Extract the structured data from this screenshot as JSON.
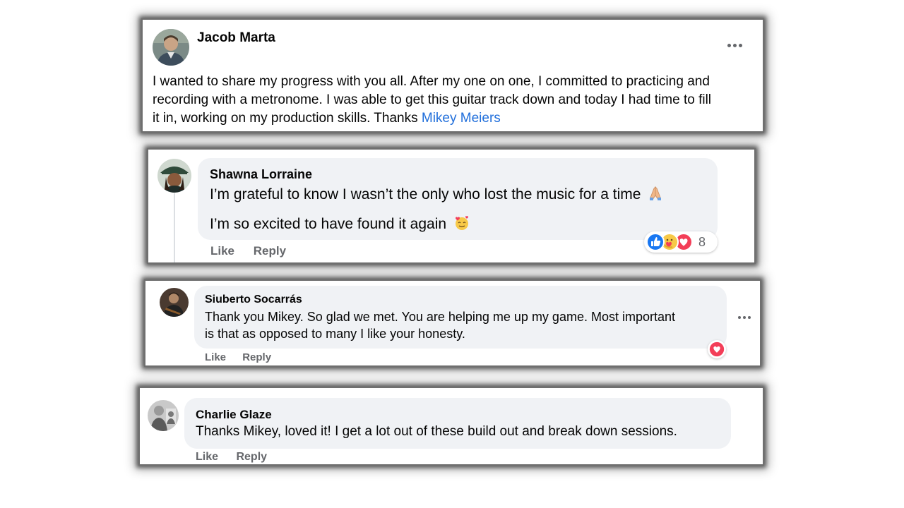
{
  "post": {
    "author": "Jacob Marta",
    "text_line1": "I wanted to share my progress with you all. After my one on one, I committed to practicing and",
    "text_line2": "recording with a metronome. I was able to get this guitar track down and today I had time to fill",
    "text_line3": "it in, working on my production skills. Thanks ",
    "mention": "Mikey Meiers"
  },
  "comments": [
    {
      "author": "Shawna Lorraine",
      "line1": "I’m grateful to know I wasn’t the only who lost the music for a time",
      "line2": "I’m so excited to have found it again",
      "like_label": "Like",
      "reply_label": "Reply",
      "reaction_count": "8",
      "reactions": [
        "like-icon",
        "care-icon",
        "love-icon"
      ]
    },
    {
      "author": "Siuberto Socarrás",
      "line1": "Thank you Mikey. So glad we met. You are helping me up my game. Most important",
      "line2": "is that as opposed to many I like your honesty.",
      "like_label": "Like",
      "reply_label": "Reply",
      "reactions": [
        "love-icon"
      ]
    },
    {
      "author": "Charlie Glaze",
      "line1": "Thanks Mikey, loved it! I get a lot out of these build out and break down sessions.",
      "like_label": "Like",
      "reply_label": "Reply"
    }
  ],
  "colors": {
    "link": "#216fdb",
    "bubble": "#f0f2f5",
    "like_blue": "#1877f2",
    "love_red": "#f33e58",
    "muted": "#65676b"
  }
}
